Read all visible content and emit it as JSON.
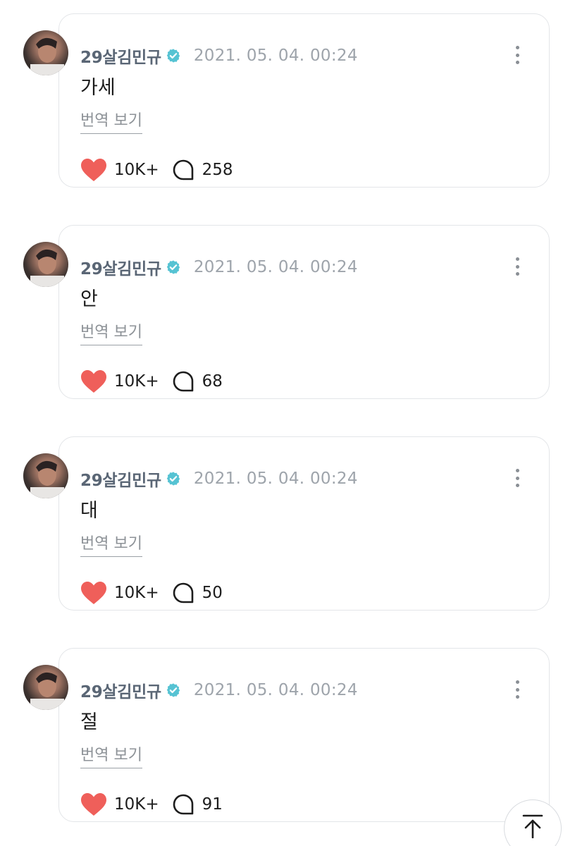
{
  "posts": [
    {
      "author": "29살김민규",
      "timestamp": "2021. 05. 04. 00:24",
      "text": "가세",
      "translate_label": "번역 보기",
      "likes": "10K+",
      "comments": "258"
    },
    {
      "author": "29살김민규",
      "timestamp": "2021. 05. 04. 00:24",
      "text": "안",
      "translate_label": "번역 보기",
      "likes": "10K+",
      "comments": "68"
    },
    {
      "author": "29살김민규",
      "timestamp": "2021. 05. 04. 00:24",
      "text": "대",
      "translate_label": "번역 보기",
      "likes": "10K+",
      "comments": "50"
    },
    {
      "author": "29살김민규",
      "timestamp": "2021. 05. 04. 00:24",
      "text": "절",
      "translate_label": "번역 보기",
      "likes": "10K+",
      "comments": "91"
    }
  ],
  "icons": {
    "verified": "verified-badge-icon",
    "more": "more-vertical-icon",
    "like": "heart-icon",
    "comment": "comment-bubble-icon",
    "scroll_top": "arrow-up-to-top-icon"
  },
  "colors": {
    "heart": "#ef5f5a",
    "verified": "#56c3d3",
    "author": "#5a6675",
    "timestamp": "#9ea4ab",
    "card_border": "#e3e5e8"
  }
}
